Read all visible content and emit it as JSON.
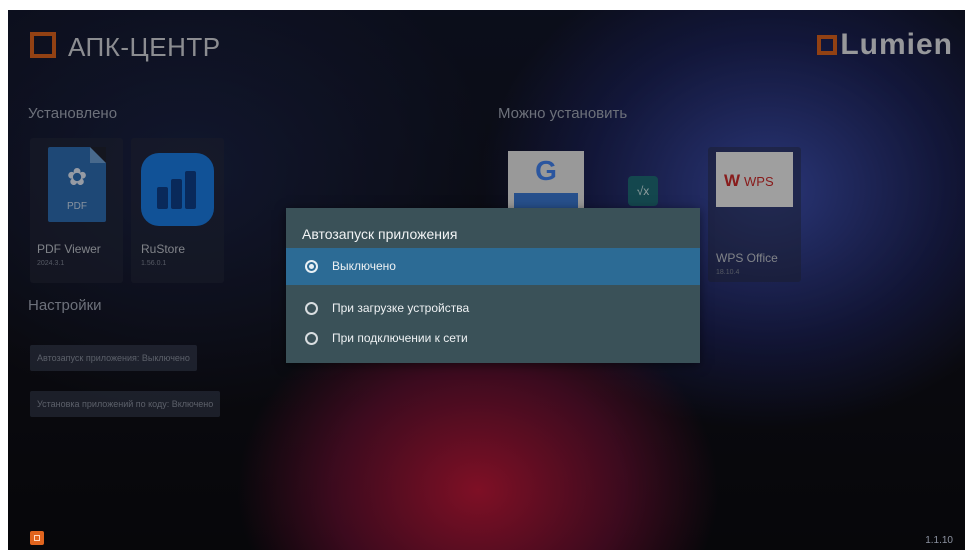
{
  "header": {
    "app_title": "АПК-ЦЕНТР",
    "brand_text": "Lumien",
    "logo_icon": "orange-square-icon"
  },
  "installed": {
    "section_title": "Установлено",
    "apps": [
      {
        "name": "PDF Viewer",
        "version": "2024.3.1",
        "icon": "pdf-file-icon"
      },
      {
        "name": "RuStore",
        "version": "1.56.0.1",
        "icon": "rustore-icon"
      }
    ]
  },
  "available": {
    "section_title": "Можно установить",
    "apps": [
      {
        "name": "",
        "version": "",
        "icon": "gboard-icon"
      },
      {
        "name": "",
        "version": "",
        "icon": "calculator-icon"
      },
      {
        "name": "WPS Office",
        "version": "18.10.4",
        "icon": "wps-icon"
      }
    ]
  },
  "settings": {
    "section_title": "Настройки",
    "items": [
      "Автозапуск приложения: Выключено",
      "Установка приложений по коду: Включено"
    ]
  },
  "dialog": {
    "title": "Автозапуск приложения",
    "options": [
      {
        "label": "Выключено",
        "selected": true
      },
      {
        "label": "При загрузке устройства",
        "selected": false
      },
      {
        "label": "При подключении к сети",
        "selected": false
      }
    ]
  },
  "footer": {
    "version": "1.1.10",
    "exit_icon": "exit-icon"
  },
  "colors": {
    "accent": "#e0641e",
    "dialog_bg": "#3a5158",
    "selected_bg": "#2c6b95"
  }
}
